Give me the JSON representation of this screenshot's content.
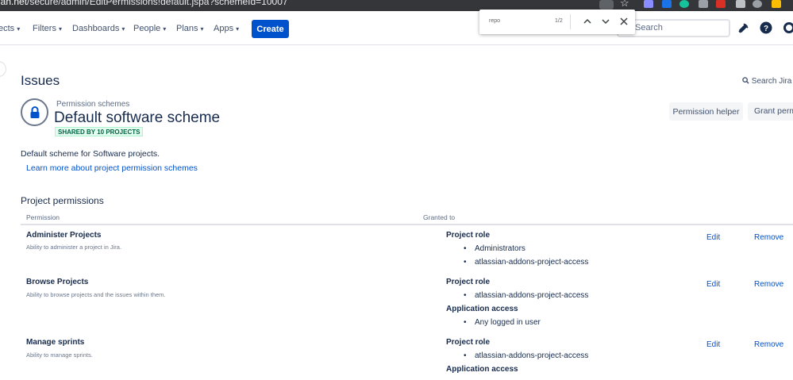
{
  "browser": {
    "url_prefix": "ian.net",
    "url_path": "/secure/admin/EditPermissions!default.jspa?schemeId=10007"
  },
  "find_bar": {
    "query": "repo",
    "count": "1/2"
  },
  "nav": {
    "items": [
      {
        "label": "ects"
      },
      {
        "label": "Filters"
      },
      {
        "label": "Dashboards"
      },
      {
        "label": "People"
      },
      {
        "label": "Plans"
      },
      {
        "label": "Apps"
      }
    ],
    "create_label": "Create",
    "search_placeholder": "Search"
  },
  "page": {
    "title": "Issues",
    "search_jira": "Search Jira a",
    "breadcrumb": "Permission schemes",
    "scheme_name": "Default software scheme",
    "shared_badge": "SHARED BY 10 PROJECTS",
    "permission_helper": "Permission helper",
    "grant_permissions": "Grant perm",
    "description": "Default scheme for Software projects.",
    "learn_more": "Learn more about project permission schemes"
  },
  "table": {
    "section_title": "Project permissions",
    "col_permission": "Permission",
    "col_granted": "Granted to",
    "edit_label": "Edit",
    "remove_label": "Remove",
    "rows": [
      {
        "name": "Administer Projects",
        "description": "Ability to administer a project in Jira.",
        "group1": "Project role",
        "group1_items": [
          "Administrators",
          "atlassian-addons-project-access"
        ]
      },
      {
        "name": "Browse Projects",
        "description": "Ability to browse projects and the issues within them.",
        "group1": "Project role",
        "group1_items": [
          "atlassian-addons-project-access"
        ],
        "group2": "Application access",
        "group2_items": [
          "Any logged in user"
        ]
      },
      {
        "name": "Manage sprints",
        "description": "Ability to manage sprints.",
        "group1": "Project role",
        "group1_items": [
          "atlassian-addons-project-access"
        ],
        "group2": "Application access"
      }
    ]
  },
  "colors": {
    "primary": "#0052cc",
    "text": "#172b4d",
    "badge_green": "#006644"
  }
}
